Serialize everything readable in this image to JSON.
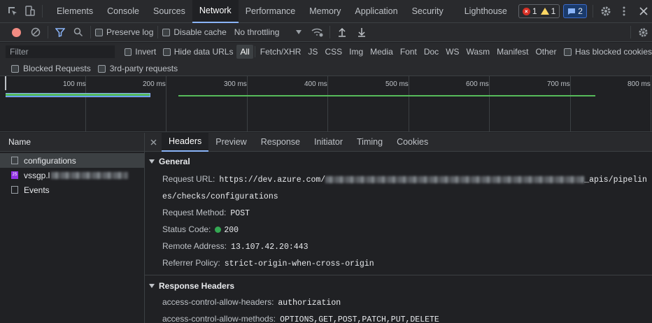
{
  "topbar": {
    "tabs": [
      "Elements",
      "Console",
      "Sources",
      "Network",
      "Performance",
      "Memory",
      "Application",
      "Security",
      "Lighthouse"
    ],
    "active_tab": "Network",
    "errors": "1",
    "warnings": "1",
    "messages": "2"
  },
  "toolbar": {
    "preserve_log": "Preserve log",
    "disable_cache": "Disable cache",
    "throttling": "No throttling"
  },
  "filter": {
    "placeholder": "Filter",
    "invert": "Invert",
    "hide_data_urls": "Hide data URLs",
    "types": [
      "All",
      "Fetch/XHR",
      "JS",
      "CSS",
      "Img",
      "Media",
      "Font",
      "Doc",
      "WS",
      "Wasm",
      "Manifest",
      "Other"
    ],
    "has_blocked_cookies": "Has blocked cookies",
    "blocked_requests": "Blocked Requests",
    "third_party": "3rd-party requests"
  },
  "overview": {
    "ticks": [
      "100 ms",
      "200 ms",
      "300 ms",
      "400 ms",
      "500 ms",
      "600 ms",
      "700 ms",
      "800 ms"
    ]
  },
  "requests": {
    "header": "Name",
    "rows": [
      "configurations",
      "vssgp.l",
      "Events"
    ]
  },
  "details": {
    "tabs": [
      "Headers",
      "Preview",
      "Response",
      "Initiator",
      "Timing",
      "Cookies"
    ],
    "active_tab": "Headers",
    "general": {
      "title": "General",
      "request_url_label": "Request URL:",
      "request_url_start": "https://dev.azure.com/",
      "request_url_mid": "_apis/pipelin",
      "request_url_end": "es/checks/configurations",
      "method_label": "Request Method:",
      "method": "POST",
      "status_label": "Status Code:",
      "status": "200",
      "remote_label": "Remote Address:",
      "remote": "13.107.42.20:443",
      "referrer_label": "Referrer Policy:",
      "referrer": "strict-origin-when-cross-origin"
    },
    "response_headers": {
      "title": "Response Headers",
      "acah_label": "access-control-allow-headers:",
      "acah": "authorization",
      "acam_label": "access-control-allow-methods:",
      "acam": "OPTIONS,GET,POST,PATCH,PUT,DELETE"
    }
  }
}
